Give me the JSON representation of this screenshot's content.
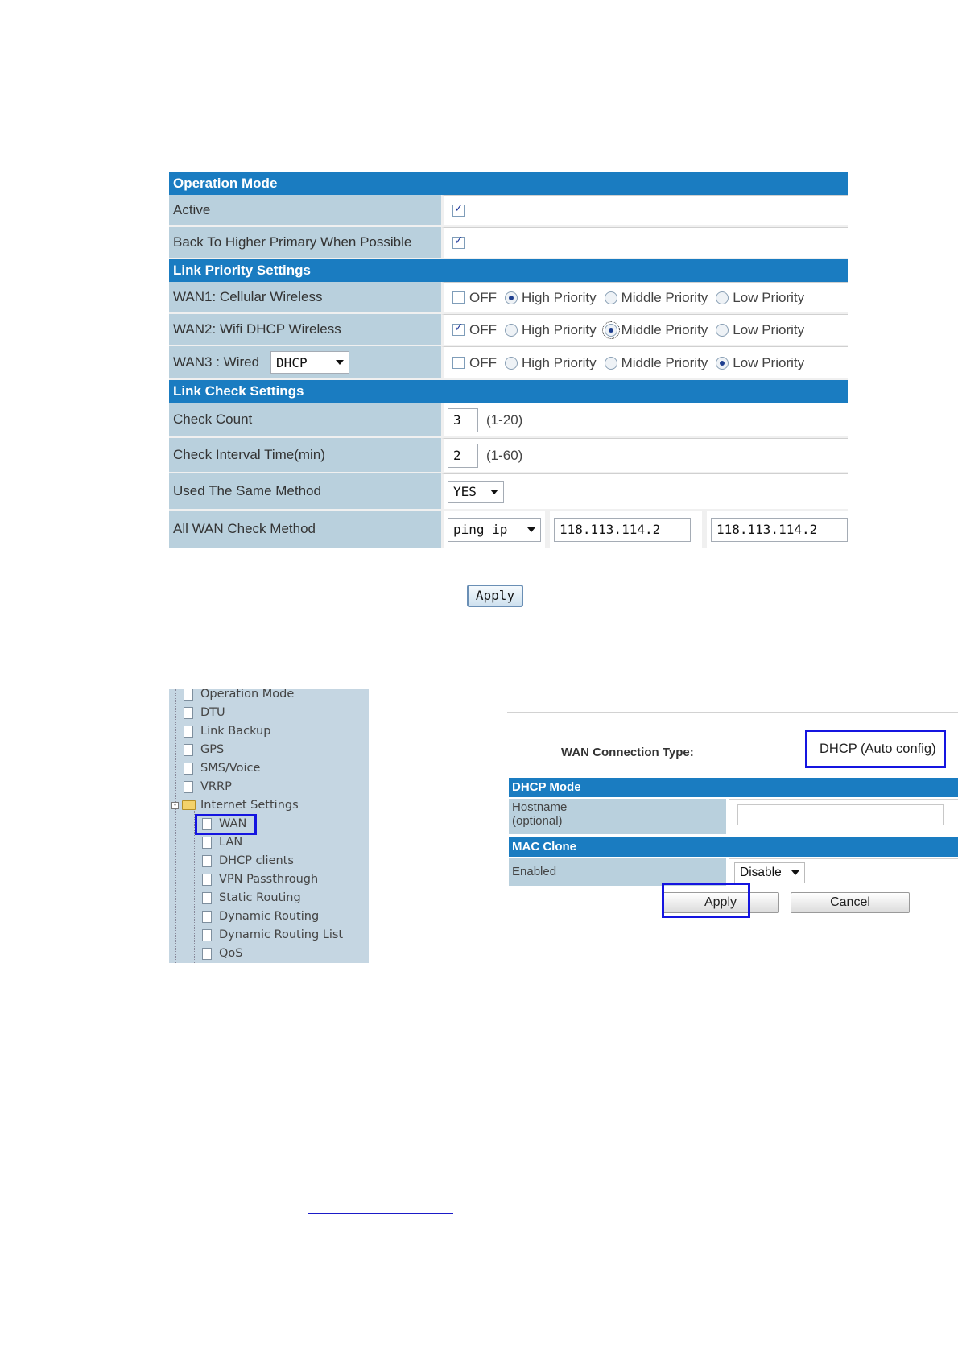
{
  "operation_mode": {
    "header": "Operation Mode",
    "rows": [
      {
        "label": "Active",
        "checked": true
      },
      {
        "label": "Back To Higher Primary When Possible",
        "checked": true
      }
    ]
  },
  "link_priority": {
    "header": "Link Priority Settings",
    "option_labels": [
      "OFF",
      "High Priority",
      "Middle Priority",
      "Low Priority"
    ],
    "wans": [
      {
        "label": "WAN1:  Cellular Wireless",
        "off": false,
        "selected": "High Priority"
      },
      {
        "label": "WAN2:  Wifi DHCP Wireless",
        "off": true,
        "selected": "Middle Priority"
      },
      {
        "label": "WAN3 : Wired",
        "select_value": "DHCP",
        "off": false,
        "selected": "Low Priority"
      }
    ]
  },
  "link_check": {
    "header": "Link Check Settings",
    "check_count": {
      "label": "Check Count",
      "value": "3",
      "range": "(1-20)"
    },
    "check_interval": {
      "label": "Check Interval Time(min)",
      "value": "2",
      "range": "(1-60)"
    },
    "same_method": {
      "label": "Used The Same Method",
      "value": "YES"
    },
    "all_wan_method": {
      "label": "All WAN Check Method",
      "method": "ping ip",
      "ip1": "118.113.114.2",
      "ip2": "118.113.114.2"
    }
  },
  "apply_label": "Apply",
  "tree": {
    "items": [
      "Operation Mode",
      "DTU",
      "Link Backup",
      "GPS",
      "SMS/Voice",
      "VRRP"
    ],
    "folder": "Internet Settings",
    "children": [
      "WAN",
      "LAN",
      "DHCP clients",
      "VPN Passthrough",
      "Static Routing",
      "Dynamic Routing",
      "Dynamic Routing List",
      "QoS"
    ]
  },
  "wan_form": {
    "type_label": "WAN Connection Type:",
    "type_value": "DHCP (Auto config)",
    "dhcp_header": "DHCP Mode",
    "hostname_label_1": "Hostname",
    "hostname_label_2": "(optional)",
    "hostname_value": "",
    "mac_header": "MAC Clone",
    "enabled_label": "Enabled",
    "enabled_value": "Disable",
    "apply": "Apply",
    "cancel": "Cancel"
  },
  "colors": {
    "header_blue": "#1a7cc1",
    "label_bg": "#b9d0dd",
    "highlight": "#1515e0"
  }
}
